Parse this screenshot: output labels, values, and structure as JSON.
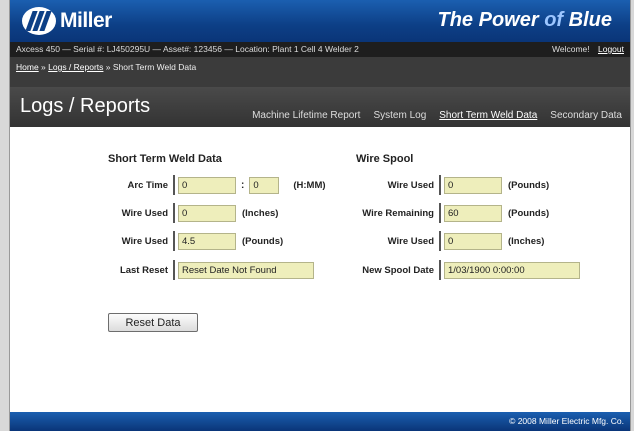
{
  "header": {
    "brand": "Miller",
    "slogan_prefix": "The Power ",
    "slogan_of": "of",
    "slogan_suffix": " Blue"
  },
  "info": {
    "text": "Axcess 450 — Serial #: LJ450295U — Asset#: 123456 — Location: Plant 1 Cell 4 Welder 2",
    "welcome": "Welcome!",
    "logout": "Logout"
  },
  "breadcrumb": {
    "home": "Home",
    "sep1": " » ",
    "logs": "Logs / Reports",
    "sep2": " » ",
    "current": "Short Term Weld Data"
  },
  "page_title": "Logs / Reports",
  "tabs": [
    {
      "label": "Machine Lifetime Report"
    },
    {
      "label": "System Log"
    },
    {
      "label": "Short Term Weld Data",
      "active": true
    },
    {
      "label": "Secondary Data"
    }
  ],
  "short_term": {
    "title": "Short Term Weld Data",
    "arc_time_label": "Arc Time",
    "arc_hours": "0",
    "arc_minutes": "0",
    "arc_colon": ":",
    "arc_unit": "(H:MM)",
    "wire_used_in_label": "Wire Used",
    "wire_used_in": "0",
    "wire_used_in_unit": "(Inches)",
    "wire_used_lb_label": "Wire Used",
    "wire_used_lb": "4.5",
    "wire_used_lb_unit": "(Pounds)",
    "last_reset_label": "Last Reset",
    "last_reset": "Reset Date Not Found"
  },
  "wire_spool": {
    "title": "Wire Spool",
    "wire_used_lb_label": "Wire Used",
    "wire_used_lb": "0",
    "wire_used_lb_unit": "(Pounds)",
    "wire_remaining_label": "Wire Remaining",
    "wire_remaining": "60",
    "wire_remaining_unit": "(Pounds)",
    "wire_used_in_label": "Wire Used",
    "wire_used_in": "0",
    "wire_used_in_unit": "(Inches)",
    "new_spool_label": "New Spool Date",
    "new_spool": "1/03/1900 0:00:00"
  },
  "reset_button": "Reset Data",
  "footer": "© 2008 Miller Electric Mfg. Co."
}
